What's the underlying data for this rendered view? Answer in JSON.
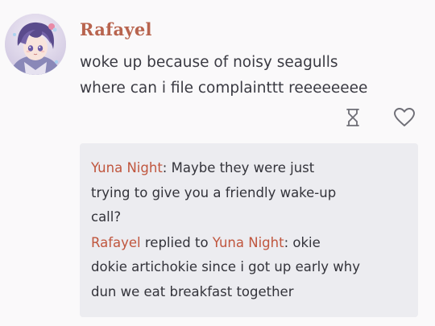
{
  "post": {
    "author": "Rafayel",
    "avatar_icon": "anime-character-avatar",
    "lines": [
      "woke up because of noisy seagulls",
      "where can i file complainttt reeeeeeee"
    ]
  },
  "actions": {
    "hourglass_icon": "hourglass-icon",
    "heart_icon": "heart-icon"
  },
  "replies": [
    {
      "author": "Yuna Night",
      "separator": ":",
      "lines": [
        " Maybe they were just",
        "trying to give you a friendly wake-up",
        "call?"
      ]
    },
    {
      "author": "Rafayel",
      "replied_to_text": " replied to ",
      "target": "Yuna Night",
      "separator": ":",
      "lines": [
        " okie",
        "dokie artichokie since i got up early why",
        "dun we eat breakfast together"
      ]
    }
  ],
  "colors": {
    "author_name": "#b8644e",
    "mention": "#c0563e",
    "reply_box": "#ececf0",
    "background": "#faf9fa"
  }
}
